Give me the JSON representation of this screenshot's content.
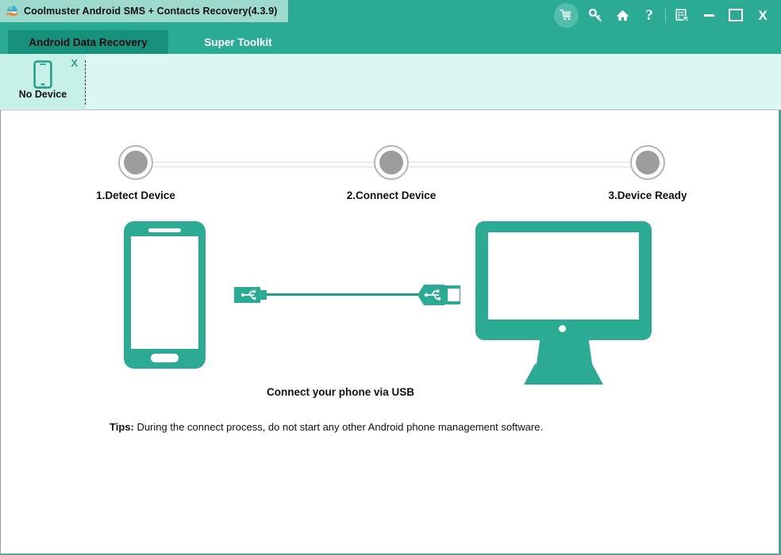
{
  "window": {
    "title": "Coolmuster Android SMS + Contacts Recovery(4.3.9)",
    "app_icon": "coolmuster-globe-icon",
    "accent_color": "#2cab94",
    "title_chip_color": "#9ed9cd",
    "controls": {
      "cart": "cart-icon",
      "key": "key-icon",
      "home": "home-icon",
      "help": "?",
      "register": "register-icon",
      "minimize": "minimize-icon",
      "maximize": "maximize-icon",
      "close": "X"
    }
  },
  "tabs": [
    {
      "label": "Android Data Recovery",
      "active": true
    },
    {
      "label": "Super Toolkit",
      "active": false
    }
  ],
  "device_strip": {
    "card": {
      "icon": "phone-icon",
      "close_label": "X",
      "label": "No Device"
    }
  },
  "steps": [
    {
      "label": "1.Detect Device"
    },
    {
      "label": "2.Connect Device"
    },
    {
      "label": "3.Device Ready"
    }
  ],
  "illustration": {
    "phone_alt": "smartphone-illustration",
    "monitor_alt": "computer-monitor-illustration",
    "cable_label": "Connect your phone via USB",
    "usb_left_alt": "usb-connector-icon",
    "usb_right_alt": "usb-connector-icon",
    "teal": "#2cab94"
  },
  "tips": {
    "prefix": "Tips:",
    "text": " During the connect process, do not start any other Android phone management software."
  }
}
